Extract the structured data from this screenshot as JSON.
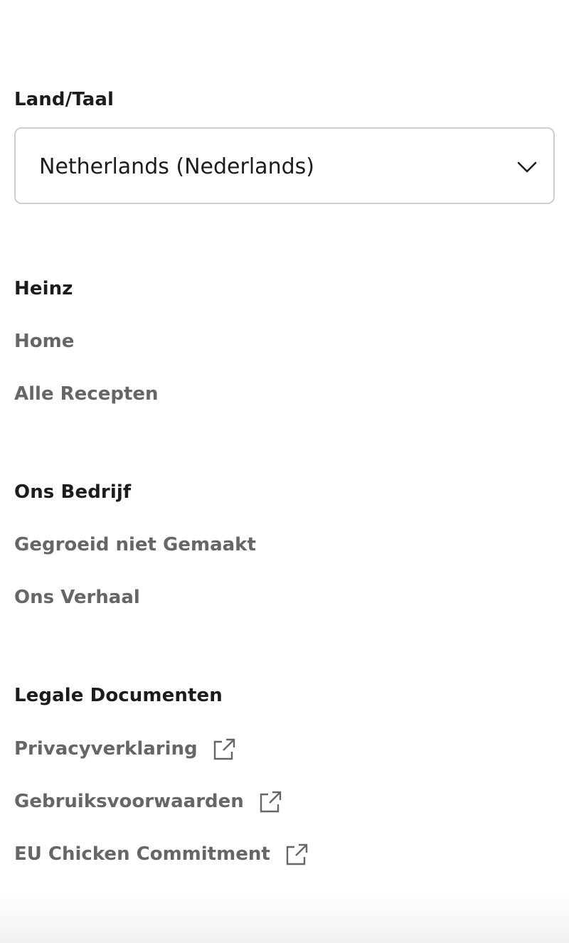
{
  "country_language": {
    "label": "Land/Taal",
    "selected": "Netherlands (Nederlands)",
    "icon": "chevron-down-icon"
  },
  "sections": [
    {
      "title": "Heinz",
      "links": [
        {
          "label": "Home",
          "external": false
        },
        {
          "label": "Alle Recepten",
          "external": false
        }
      ]
    },
    {
      "title": "Ons Bedrijf",
      "links": [
        {
          "label": "Gegroeid niet Gemaakt",
          "external": false
        },
        {
          "label": "Ons Verhaal",
          "external": false
        }
      ]
    },
    {
      "title": "Legale Documenten",
      "links": [
        {
          "label": "Privacyverklaring",
          "external": true,
          "icon": "external-link-icon"
        },
        {
          "label": "Gebruiksvoorwaarden",
          "external": true,
          "icon": "external-link-icon"
        },
        {
          "label": "EU Chicken Commitment",
          "external": true,
          "icon": "external-link-icon"
        }
      ]
    }
  ],
  "colors": {
    "heading": "#1c1c1c",
    "link": "#666666",
    "border": "#cfcfcf"
  }
}
